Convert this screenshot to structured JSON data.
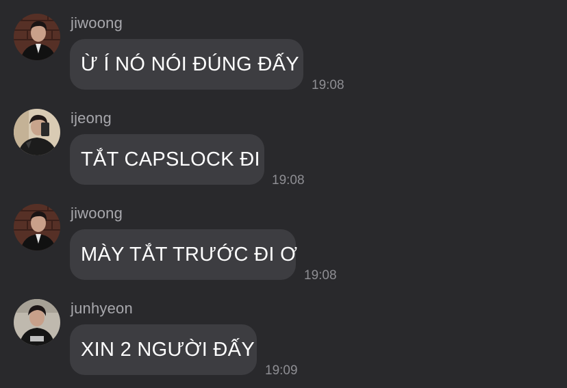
{
  "messages": [
    {
      "sender": "jiwoong",
      "text": "Ừ Í NÓ NÓI ĐÚNG ĐẤY",
      "time": "19:08",
      "avatar_icon": "avatar-jiwoong-icon"
    },
    {
      "sender": "ijeong",
      "text": "TẮT CAPSLOCK ĐI",
      "time": "19:08",
      "avatar_icon": "avatar-ijeong-icon"
    },
    {
      "sender": "jiwoong",
      "text": "MÀY TẮT TRƯỚC ĐI Ơ",
      "time": "19:08",
      "avatar_icon": "avatar-jiwoong-icon"
    },
    {
      "sender": "junhyeon",
      "text": "XIN 2 NGƯỜI ĐẤY",
      "time": "19:09",
      "avatar_icon": "avatar-junhyeon-icon"
    }
  ],
  "colors": {
    "background": "#29292c",
    "bubble": "#3d3d41",
    "sender_text": "#a8a8ad",
    "time_text": "#8e8e93",
    "message_text": "#ffffff"
  }
}
